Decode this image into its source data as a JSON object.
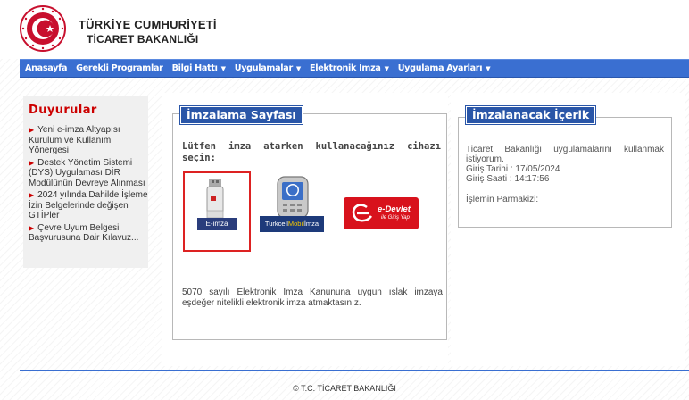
{
  "header": {
    "ministry_line1": "TÜRKİYE CUMHURİYETİ",
    "ministry_line2": "TİCARET BAKANLIĞI"
  },
  "nav": {
    "items": [
      {
        "label": "Anasayfa",
        "dropdown": false
      },
      {
        "label": "Gerekli Programlar",
        "dropdown": false
      },
      {
        "label": "Bilgi Hattı",
        "dropdown": true
      },
      {
        "label": "Uygulamalar",
        "dropdown": true
      },
      {
        "label": "Elektronik İmza",
        "dropdown": true
      },
      {
        "label": "Uygulama Ayarları",
        "dropdown": true
      }
    ],
    "caret": "▼"
  },
  "sidebar": {
    "title": "Duyurular",
    "items": [
      {
        "label": "Yeni e-imza Altyapısı Kurulum ve Kullanım Yönergesi"
      },
      {
        "label": "Destek Yönetim Sistemi (DYS) Uygulaması DİR Modülünün Devreye Alınması"
      },
      {
        "label": "2024 yılında Dahilde İşleme İzin Belgelerinde değişen GTİPler"
      },
      {
        "label": "Çevre Uyum Belgesi Başvurusuna Dair Kılavuz..."
      }
    ]
  },
  "signing": {
    "title": "İmzalama Sayfası",
    "prompt": "Lütfen imza atarken kullanacağınız cihazı seçin:",
    "options": [
      {
        "label": "E-imza",
        "selected": true
      },
      {
        "label_part1": "Turkcell",
        "label_part2": "Mobil",
        "label_part3": "İmza"
      },
      {
        "label": "e-Devlet",
        "sublabel": "ile Giriş Yap"
      }
    ],
    "law_text": "5070 sayılı Elektronik İmza Kanununa uygun ıslak imzaya eşdeğer nitelikli elektronik imza atmaktasınız."
  },
  "content": {
    "title": "İmzalanacak İçerik",
    "intro": "Ticaret Bakanlığı uygulamalarını kullanmak istiyorum.",
    "date_line": "Giriş Tarihi : 17/05/2024",
    "time_line": "Giriş Saati : 14:17:56",
    "fingerprint_label": "İşlemin Parmakizi:"
  },
  "footer": {
    "text": "© T.C. TİCARET BAKANLIĞI"
  },
  "colors": {
    "nav_blue": "#3a6fd1",
    "legend_blue": "#2a56a8",
    "accent_red": "#cc0000",
    "selected_border": "#dd2222"
  }
}
